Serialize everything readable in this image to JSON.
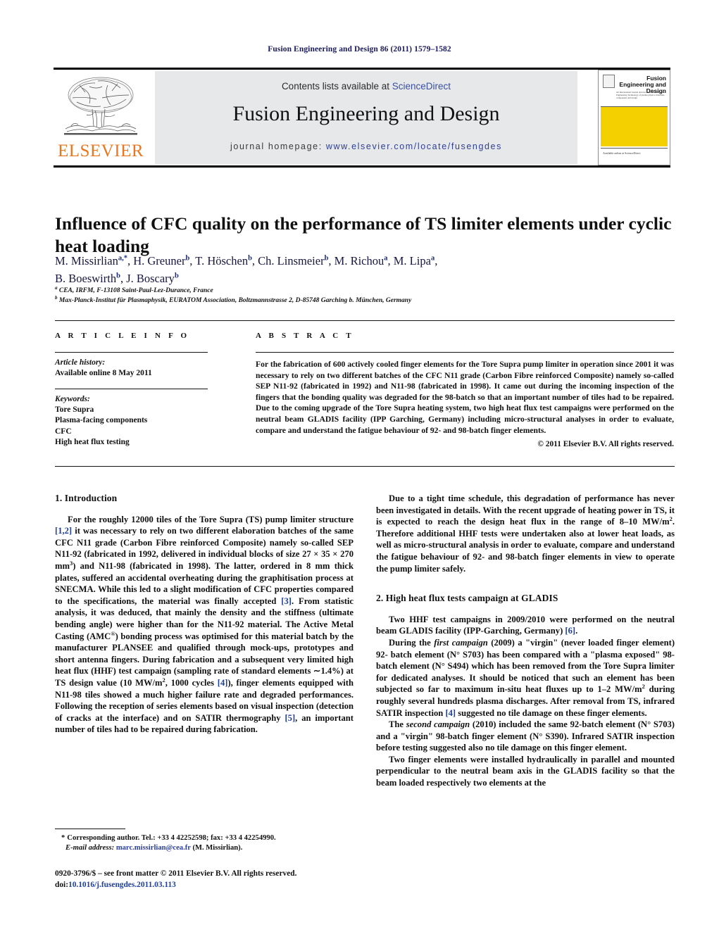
{
  "running_head": "Fusion Engineering and Design 86 (2011) 1579–1582",
  "masthead": {
    "publisher_name": "ELSEVIER",
    "contents_prefix": "Contents lists available at ",
    "contents_link": "ScienceDirect",
    "journal_name": "Fusion Engineering and Design",
    "homepage_prefix": "journal homepage: ",
    "homepage_url": "www.elsevier.com/locate/fusengdes",
    "cover": {
      "title": "Fusion Engineering and Design",
      "subtitle_lines": "An International Journal devoted to the Fusion Reactor Engineering Technology of plasma physics, materials, components and design",
      "bottom_text": "Available online at ScienceDirect",
      "accent_color": "#F5D000"
    }
  },
  "article": {
    "title": "Influence of CFC quality on the performance of TS limiter elements under cyclic heat loading",
    "authors_line1": "M. Missirlian",
    "authors": [
      {
        "name": "M. Missirlian",
        "sup": "a,*"
      },
      {
        "name": "H. Greuner",
        "sup": "b"
      },
      {
        "name": "T. Höschen",
        "sup": "b"
      },
      {
        "name": "Ch. Linsmeier",
        "sup": "b"
      },
      {
        "name": "M. Richou",
        "sup": "a"
      },
      {
        "name": "M. Lipa",
        "sup": "a"
      },
      {
        "name": "B. Boeswirth",
        "sup": "b"
      },
      {
        "name": "J. Boscary",
        "sup": "b"
      }
    ],
    "affiliations": [
      {
        "sup": "a",
        "text": "CEA, IRFM, F-13108 Saint-Paul-Lez-Durance, France"
      },
      {
        "sup": "b",
        "text": "Max-Planck-Institut für Plasmaphysik, EURATOM Association, Boltzmannstrasse 2, D-85748 Garching b. München, Germany"
      }
    ]
  },
  "info": {
    "header_article_info": "A R T I C L E   I N F O",
    "header_abstract": "A B S T R A C T",
    "history_label": "Article history:",
    "history_value": "Available online 8 May 2011",
    "keywords_label": "Keywords:",
    "keywords": [
      "Tore Supra",
      "Plasma-facing components",
      "CFC",
      "High heat flux testing"
    ]
  },
  "abstract": {
    "text": "For the fabrication of 600 actively cooled finger elements for the Tore Supra pump limiter in operation since 2001 it was necessary to rely on two different batches of the CFC N11 grade (Carbon Fibre reinforced Composite) namely so-called SEP N11-92 (fabricated in 1992) and N11-98 (fabricated in 1998). It came out during the incoming inspection of the fingers that the bonding quality was degraded for the 98-batch so that an important number of tiles had to be repaired. Due to the coming upgrade of the Tore Supra heating system, two high heat flux test campaigns were performed on the neutral beam GLADIS facility (IPP Garching, Germany) including micro-structural analyses in order to evaluate, compare and understand the fatigue behaviour of 92- and 98-batch finger elements.",
    "copyright": "© 2011 Elsevier B.V. All rights reserved."
  },
  "body": {
    "section1_title": "1.  Introduction",
    "section2_title": "2.  High heat flux tests campaign at GLADIS",
    "left_p1_a": "For the roughly 12000 tiles of the Tore Supra (TS) pump limiter structure ",
    "left_p1_ref1": "[1,2]",
    "left_p1_b": " it was necessary to rely on two different elaboration batches of the same CFC N11 grade (Carbon Fibre reinforced Composite) namely so-called SEP N11-92 (fabricated in 1992, delivered in individual blocks of size 27 × 35 × 270 mm",
    "left_p1_sup1": "3",
    "left_p1_c": ") and N11-98 (fabricated in 1998). The latter, ordered in 8 mm thick plates, suffered an accidental overheating during the graphitisation process at SNECMA. While this led to a slight modification of CFC properties compared to the specifications, the material was finally accepted ",
    "left_p1_ref2": "[3]",
    "left_p1_d": ". From statistic analysis, it was deduced, that mainly the density and the stiffness (ultimate bending angle) were higher than for the N11-92 material. The Active Metal Casting (AMC",
    "left_p1_sup2": "®",
    "left_p1_e": ") bonding process was optimised for this material batch by the manufacturer PLANSEE and qualified through mock-ups, prototypes and short antenna fingers. During fabrication and a subsequent very limited high heat flux (HHF) test campaign (sampling rate of standard elements ∼1.4%) at TS design value (10 MW/m",
    "left_p1_sup3": "2",
    "left_p1_f": ", 1000 cycles ",
    "left_p1_ref3": "[4]",
    "left_p1_g": "), finger elements equipped with N11-98 tiles showed a much higher failure rate and degraded performances. Following the reception of series elements based on visual inspection (detection of cracks at the interface) and on SATIR thermography ",
    "left_p1_ref4": "[5]",
    "left_p1_h": ", an important number of tiles had to be repaired during fabrication.",
    "right_p1_a": "Due to a tight time schedule, this degradation of performance has never been investigated in details. With the recent upgrade of heating power in TS, it is expected to reach the design heat flux in the range of 8–10 MW/m",
    "right_p1_sup1": "2",
    "right_p1_b": ". Therefore additional HHF tests were undertaken also at lower heat loads, as well as micro-structural analysis in order to evaluate, compare and understand the fatigue behaviour of 92- and 98-batch finger elements in view to operate the pump limiter safely.",
    "right_p2_a": "Two HHF test campaigns in 2009/2010 were performed on the neutral beam GLADIS facility (IPP-Garching, Germany) ",
    "right_p2_ref1": "[6]",
    "right_p2_b": ".",
    "right_p3_a": "During the ",
    "right_p3_ital1": "first campaign",
    "right_p3_b": " (2009) a \"virgin\" (never loaded finger element) 92- batch element (N° S703) has been compared with a \"plasma exposed\" 98-batch element (N° S494) which has been removed from the Tore Supra limiter for dedicated analyses. It should be noticed that such an element has been subjected so far to maximum in-situ heat fluxes up to 1–2 MW/m",
    "right_p3_sup1": "2",
    "right_p3_c": " during roughly several hundreds plasma discharges. After removal from TS, infrared SATIR inspection ",
    "right_p3_ref1b": "[4]",
    "right_p3_d": " suggested no tile damage on these finger elements.",
    "right_p4_a": "The ",
    "right_p4_ital1": "second campaign",
    "right_p4_b": " (2010) included the same 92-batch element (N° S703) and a \"virgin\" 98-batch finger element (N° S390). Infrared SATIR inspection before testing suggested also no tile damage on this finger element.",
    "right_p5": "Two finger elements were installed hydraulically in parallel and mounted perpendicular to the neutral beam axis in the GLADIS facility so that the beam loaded respectively two elements at the"
  },
  "footer": {
    "corresponding_star": "*",
    "corresponding_text": "Corresponding author. Tel.: +33 4 42252598; fax: +33 4 42254990.",
    "email_label": "E-mail address:",
    "email": "marc.missirlian@cea.fr",
    "email_owner": "(M. Missirlian).",
    "issn_line": "0920-3796/$ – see front matter © 2011 Elsevier B.V. All rights reserved.",
    "doi_label": "doi:",
    "doi_value": "10.1016/j.fusengdes.2011.03.113"
  }
}
